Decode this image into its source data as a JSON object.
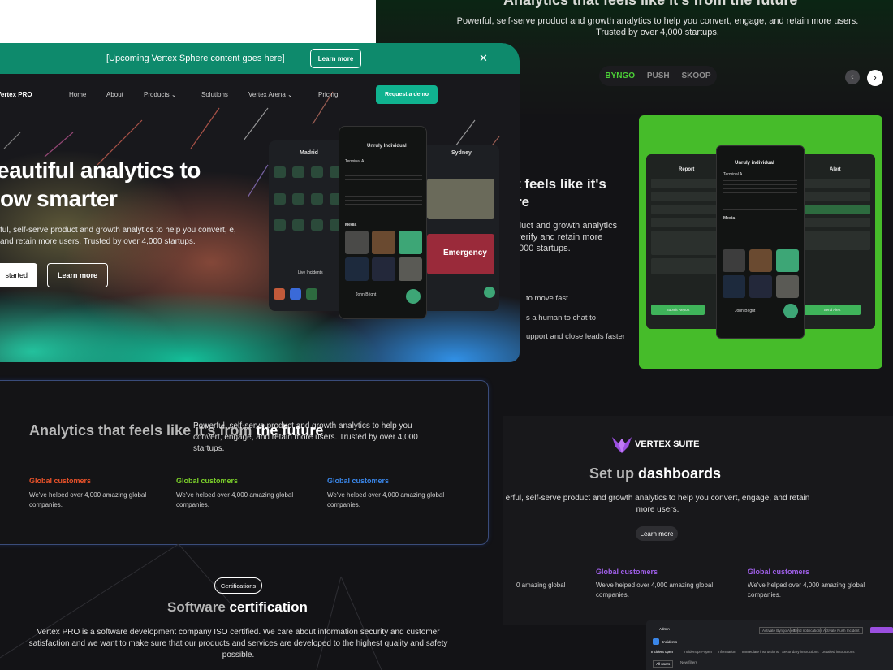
{
  "right_top": {
    "title": "Analytics that feels like it's from the future",
    "subtitle": "Powerful, self-serve product and growth analytics to help you convert, engage, and retain more users. Trusted by over 4,000 startups."
  },
  "product_tabs": [
    "BYNGO",
    "PUSH",
    "SKOOP"
  ],
  "carousel": {
    "prev": "‹",
    "next": "›"
  },
  "right_middle": {
    "title_line1": "t feels like it's",
    "title_line2": "re",
    "subtitle": "duct and growth analytics verify and retain more ,000 startups.",
    "items": [
      "to move fast",
      "s a human to chat to",
      "upport and close leads faster"
    ]
  },
  "green_card": {
    "left_header": "Report",
    "right_header": "Alert",
    "center_header": "Unruly individual",
    "center_title": "Terminal A",
    "media_label": "Media",
    "person": "John Bright",
    "submit_left": "Submit Report",
    "submit_right": "Send Alert"
  },
  "banner": {
    "text": "[Upcoming Vertex Sphere content goes here]",
    "button": "Learn more",
    "close": "✕"
  },
  "nav": {
    "logo": "Vertex PRO",
    "items": [
      "Home",
      "About",
      "Products",
      "Solutions",
      "Vertex Arena",
      "Pricing"
    ],
    "cta": "Request a demo"
  },
  "hero": {
    "headline_line1": "eautiful analytics to",
    "headline_line2": "ow smarter",
    "subtitle": "ful, self-serve product and growth analytics to help you convert, e, and retain more users. Trusted by over 4,000 startups.",
    "primary_button": "started",
    "secondary_button": "Learn more"
  },
  "phones": {
    "left_city": "Madrid",
    "right_city": "Sydney",
    "center_header": "Unruly Individual",
    "center_title": "Terminal A",
    "media_label": "Media",
    "person": "John Bright",
    "live_label": "Live Incidents",
    "emergency": "Emergency"
  },
  "analytics": {
    "title_grey": "Analytics that feels like it's from",
    "title_white": "the future",
    "subtitle": "Powerful, self-serve product and growth analytics to help you convert, engage, and retain more users. Trusted by over 4,000 startups.",
    "columns": [
      {
        "heading": "Global customers",
        "text": "We've helped over 4,000 amazing global companies.",
        "color": "#e8522a"
      },
      {
        "heading": "Global customers",
        "text": "We've helped over 4,000 amazing global companies.",
        "color": "#7bcf2a"
      },
      {
        "heading": "Global customers",
        "text": "We've helped over 4,000 amazing global companies.",
        "color": "#3a86e8"
      }
    ]
  },
  "vertex_suite": {
    "brand": "VERTEX SUITE",
    "title_grey": "Set up",
    "title_white": "dashboards",
    "subtitle": "erful, self-serve product and growth analytics to help you convert, engage, and retain more users.",
    "button": "Learn more",
    "col0_text": "0 amazing global",
    "columns": [
      {
        "heading": "Global customers",
        "text": "We've helped over 4,000 amazing global companies."
      },
      {
        "heading": "Global customers",
        "text": "We've helped over 4,000 amazing global companies."
      }
    ]
  },
  "dashboard": {
    "app": "Admin",
    "section": "Incidents",
    "tabs": [
      "Incident open",
      "Incident pre-open",
      "Information",
      "Immediate instructions",
      "Secondary instructions",
      "Detailed instructions"
    ],
    "actions": [
      "Activate Byngo Alert",
      "Send notifications",
      "Activate Push Incident"
    ],
    "filter": "All users",
    "filter2": "New filters"
  },
  "certification": {
    "pill": "Certifications",
    "title_grey": "Software",
    "title_white": "certification",
    "text": "Vertex PRO is a software development company ISO certified. We care about information security and customer satisfaction and we want to make sure that our products and services are developed to the highest quality and safety possible."
  }
}
